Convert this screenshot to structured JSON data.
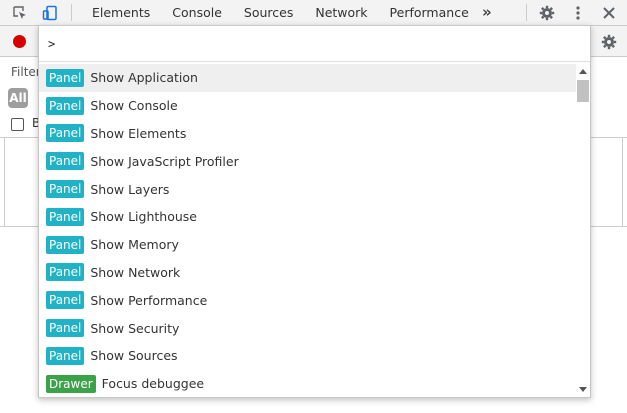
{
  "topbar": {
    "tabs": [
      "Elements",
      "Console",
      "Sources",
      "Network",
      "Performance"
    ],
    "overflow_label": "»"
  },
  "background": {
    "filter_label": "Filter",
    "all_pill_label": "All",
    "checkbox_label": "B"
  },
  "command_menu": {
    "input_value": ">",
    "items": [
      {
        "badge": "Panel",
        "label": "Show Application",
        "selected": true
      },
      {
        "badge": "Panel",
        "label": "Show Console"
      },
      {
        "badge": "Panel",
        "label": "Show Elements"
      },
      {
        "badge": "Panel",
        "label": "Show JavaScript Profiler"
      },
      {
        "badge": "Panel",
        "label": "Show Layers"
      },
      {
        "badge": "Panel",
        "label": "Show Lighthouse"
      },
      {
        "badge": "Panel",
        "label": "Show Memory"
      },
      {
        "badge": "Panel",
        "label": "Show Network"
      },
      {
        "badge": "Panel",
        "label": "Show Performance"
      },
      {
        "badge": "Panel",
        "label": "Show Security"
      },
      {
        "badge": "Panel",
        "label": "Show Sources"
      },
      {
        "badge": "Drawer",
        "label": "Focus debuggee"
      }
    ]
  },
  "colors": {
    "panel_badge": "#20b2c7",
    "drawer_badge": "#3ca24a",
    "record": "#d60000",
    "selected_row": "#efefef"
  },
  "icons": {
    "inspect": "inspect-element-icon",
    "device": "device-toolbar-icon",
    "settings": "gear-icon",
    "more": "more-vertical-icon",
    "close": "close-icon"
  }
}
